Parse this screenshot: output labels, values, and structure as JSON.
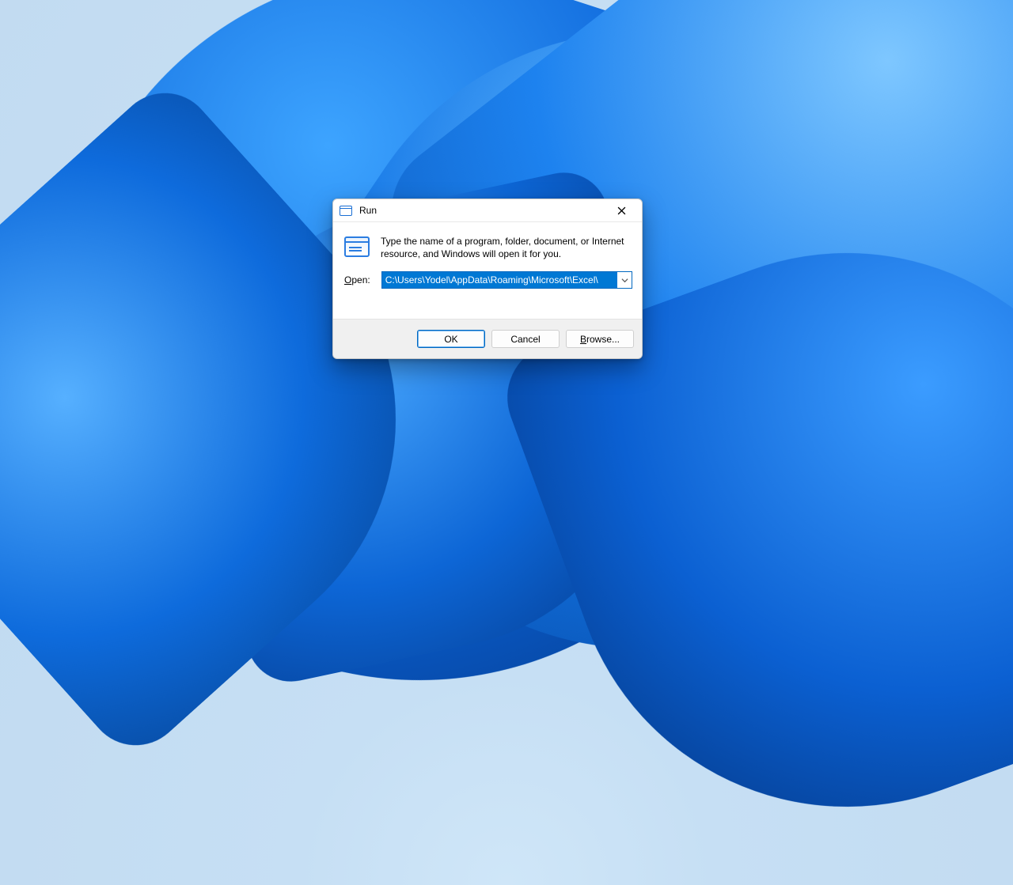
{
  "dialog": {
    "title": "Run",
    "description": "Type the name of a program, folder, document, or Internet resource, and Windows will open it for you.",
    "open_label": "Open:",
    "input_value": "C:\\Users\\Yodel\\AppData\\Roaming\\Microsoft\\Excel\\",
    "buttons": {
      "ok": "OK",
      "cancel": "Cancel",
      "browse": "Browse..."
    }
  }
}
